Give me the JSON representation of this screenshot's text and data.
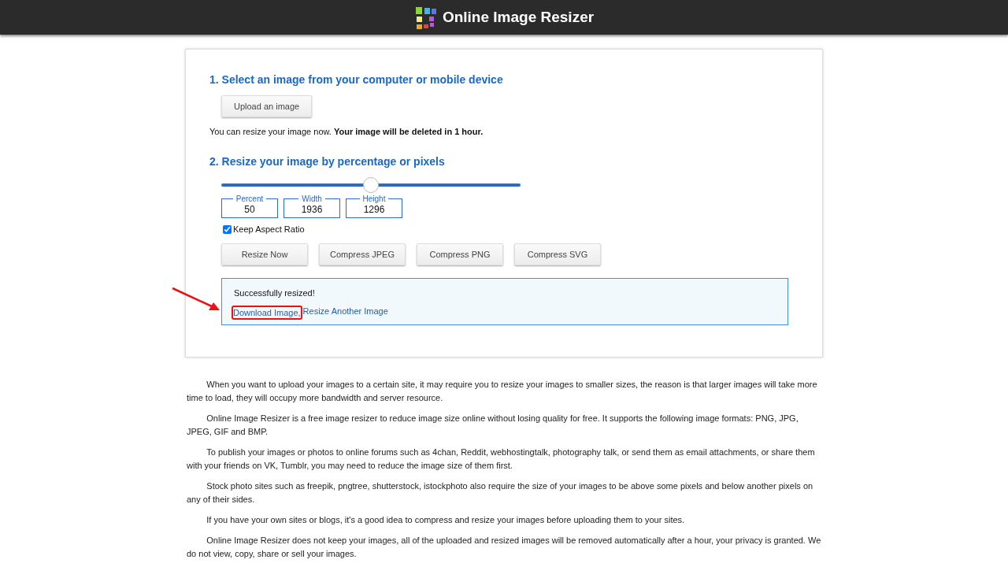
{
  "header": {
    "title": "Online Image Resizer"
  },
  "step1": {
    "heading": "1. Select an image from your computer or mobile device",
    "upload_button": "Upload an image",
    "note": "You can resize your image now. **Your image will be deleted in 1 hour.**"
  },
  "step2": {
    "heading": "2. Resize your image by percentage or pixels",
    "slider": {
      "level": 0.5
    },
    "fields": [
      {
        "label": "Percent",
        "value": "50"
      },
      {
        "label": "Width",
        "value": "1936"
      },
      {
        "label": "Height",
        "value": "1296"
      }
    ],
    "keep_aspect_ratio": {
      "label": "Keep Aspect Ratio",
      "checked": true
    },
    "buttons": [
      "Resize Now",
      "Compress JPEG",
      "Compress PNG",
      "Compress SVG"
    ]
  },
  "result": {
    "message": "Successfully resized!",
    "links": [
      {
        "label": "Download Image,",
        "highlighted": true
      },
      {
        "label": "Resize Another Image",
        "highlighted": false
      }
    ]
  },
  "paragraphs": [
    "When you want to upload your images to a certain site, it may require you to resize your images to smaller sizes, the reason is that larger images will take more time to load, they will occupy more bandwidth and server resource.",
    "Online Image Resizer is a free image resizer to reduce image size online without losing quality for free. It supports the following image formats: PNG, JPG, JPEG, GIF and BMP.",
    "To publish your images or photos to online forums such as 4chan, Reddit, webhostingtalk, photography talk, or send them as email attachments, or share them with your friends on VK, Tumblr, you may need to reduce the image size of them first.",
    "Stock photo sites such as freepik, pngtree, shutterstock, istockphoto also require the size of your images to be above some pixels and below another pixels on any of their sides.",
    "If you have your own sites or blogs, it's a good idea to compress and resize your images before uploading them to your sites.",
    "Online Image Resizer does not keep your images, all of the uploaded and resized images will be removed automatically after a hour, your privacy is granted. We do not view, copy, share or sell your images."
  ]
}
